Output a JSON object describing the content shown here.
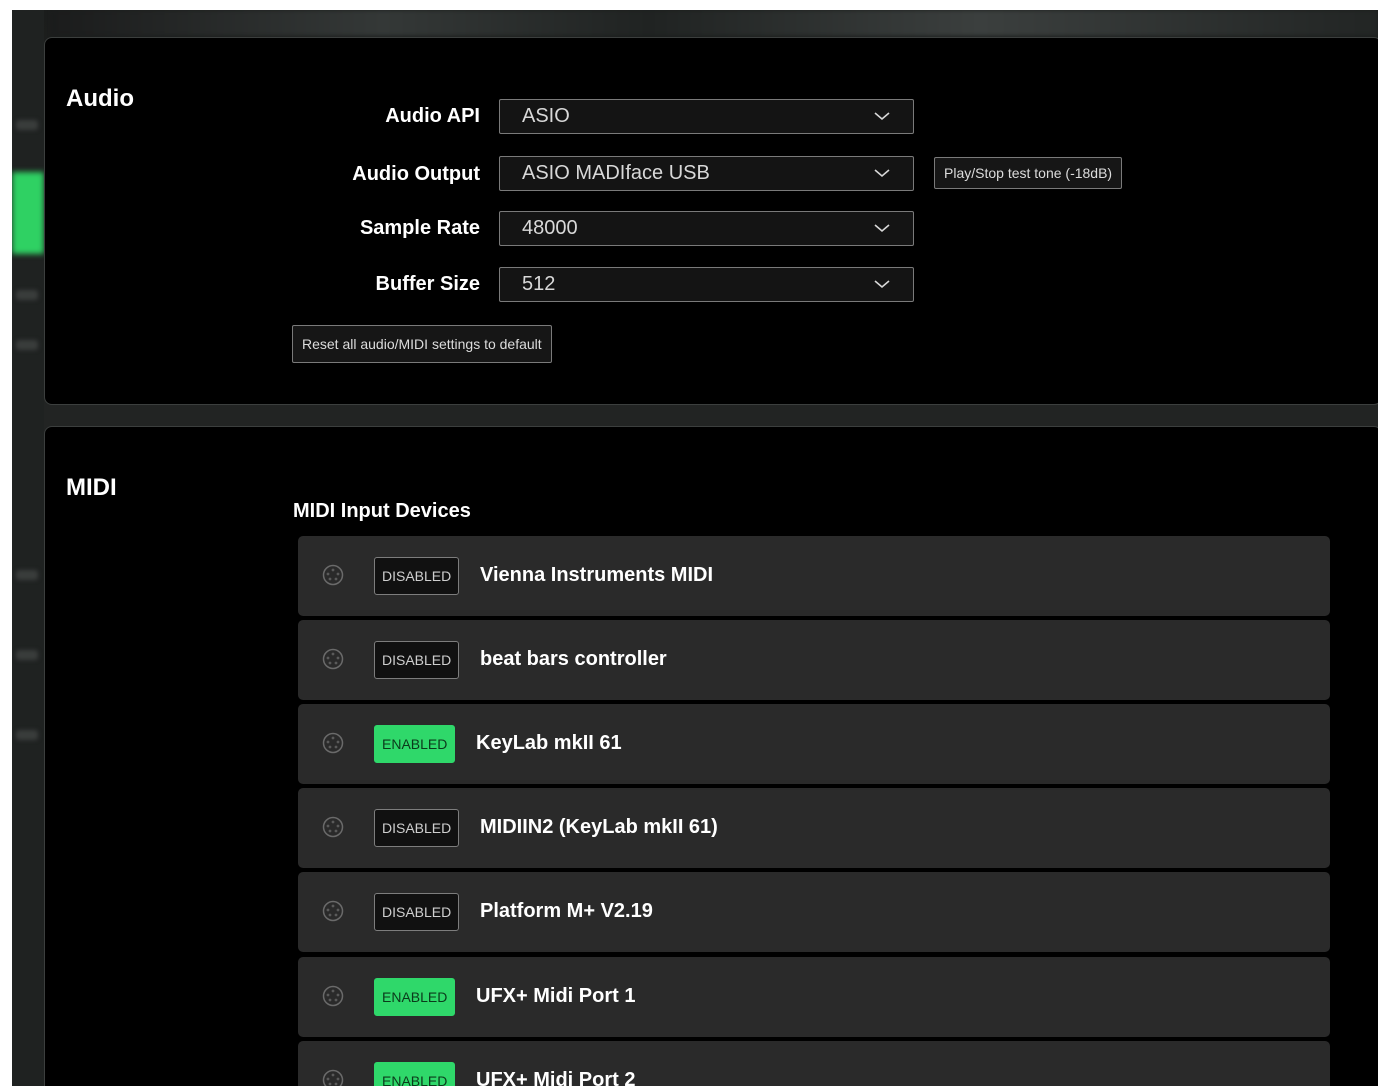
{
  "colors": {
    "accent": "#2fd86a",
    "panel_bg": "#000000",
    "row_bg": "#2a2a2a"
  },
  "audio": {
    "title": "Audio",
    "api_label": "Audio API",
    "api_value": "ASIO",
    "output_label": "Audio Output",
    "output_value": "ASIO MADIface USB",
    "test_tone_label": "Play/Stop test tone (-18dB)",
    "rate_label": "Sample Rate",
    "rate_value": "48000",
    "buffer_label": "Buffer Size",
    "buffer_value": "512",
    "reset_label": "Reset all audio/MIDI settings to default"
  },
  "midi": {
    "title": "MIDI",
    "inputs_heading": "MIDI Input Devices",
    "devices": [
      {
        "status": "DISABLED",
        "name": "Vienna Instruments MIDI",
        "icon": "midi-port-icon"
      },
      {
        "status": "DISABLED",
        "name": "beat bars controller",
        "icon": "midi-port-icon"
      },
      {
        "status": "ENABLED",
        "name": "KeyLab mkII 61",
        "icon": "midi-port-icon"
      },
      {
        "status": "DISABLED",
        "name": "MIDIIN2 (KeyLab mkII 61)",
        "icon": "midi-port-icon"
      },
      {
        "status": "DISABLED",
        "name": "Platform M+ V2.19",
        "icon": "midi-port-icon"
      },
      {
        "status": "ENABLED",
        "name": "UFX+ Midi Port 1",
        "icon": "midi-port-icon"
      },
      {
        "status": "ENABLED",
        "name": "UFX+ Midi Port 2",
        "icon": "midi-port-icon"
      }
    ]
  }
}
